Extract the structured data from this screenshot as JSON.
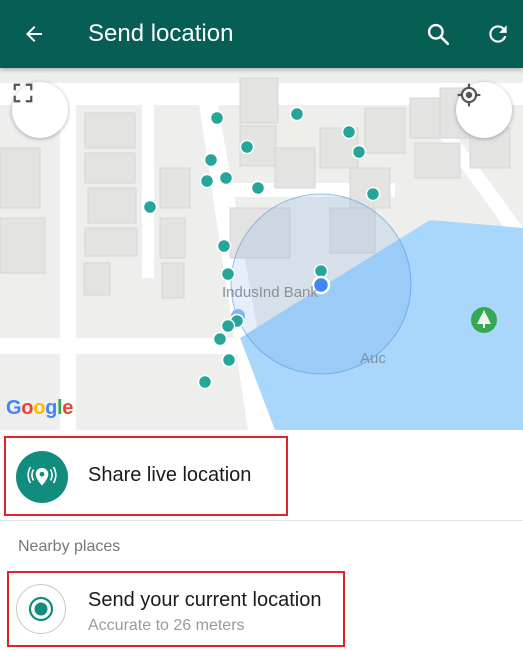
{
  "appbar": {
    "title": "Send location",
    "back_icon": "arrow-back-icon",
    "search_icon": "search-icon",
    "refresh_icon": "refresh-icon"
  },
  "map": {
    "bank_label": "IndusInd Bank",
    "water_label": "Auc",
    "attribution": "Google",
    "expand_icon": "fullscreen-icon",
    "locate_icon": "my-location-icon",
    "accuracy_color": "#4a90e2",
    "water_color": "#a9d6fb",
    "marker_color": "#26a69a"
  },
  "actions": {
    "share_live": "Share live location"
  },
  "nearby": {
    "header": "Nearby places",
    "current_title": "Send your current location",
    "current_subtitle": "Accurate to 26 meters"
  },
  "colors": {
    "primary": "#075e54",
    "accent": "#128c7e",
    "highlight": "#e0232b"
  }
}
